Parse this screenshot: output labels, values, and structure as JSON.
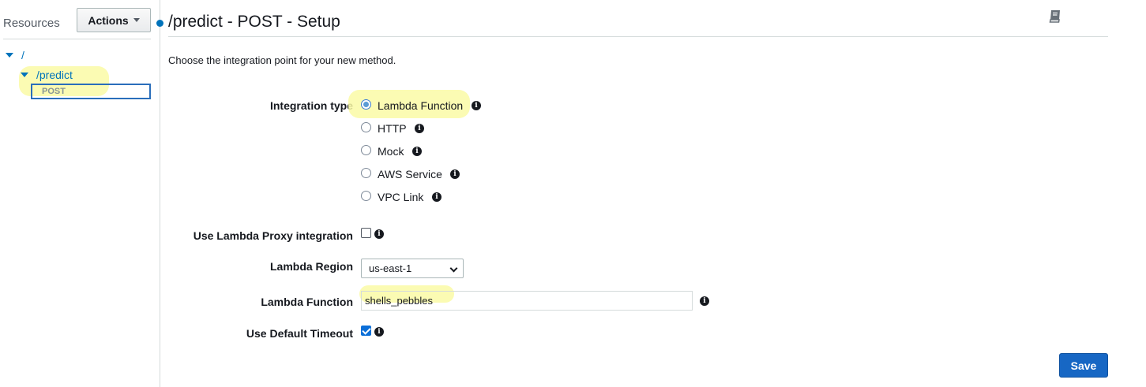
{
  "sidebar": {
    "title": "Resources",
    "actions_label": "Actions",
    "tree": {
      "root": "/",
      "child": "/predict",
      "method": "POST"
    }
  },
  "main": {
    "title": "/predict - POST - Setup",
    "intro": "Choose the integration point for your new method.",
    "integration_type": {
      "label": "Integration type",
      "options": [
        "Lambda Function",
        "HTTP",
        "Mock",
        "AWS Service",
        "VPC Link"
      ],
      "selected": "Lambda Function"
    },
    "proxy": {
      "label": "Use Lambda Proxy integration",
      "checked": false
    },
    "region": {
      "label": "Lambda Region",
      "value": "us-east-1"
    },
    "function": {
      "label": "Lambda Function",
      "value": "shells_pebbles"
    },
    "timeout": {
      "label": "Use Default Timeout",
      "checked": true
    },
    "save_label": "Save"
  },
  "icons": {
    "info": "info-icon",
    "help": "book-icon"
  },
  "colors": {
    "link": "#0073bb",
    "primary": "#1767c4",
    "highlight": "#fafaa6"
  }
}
